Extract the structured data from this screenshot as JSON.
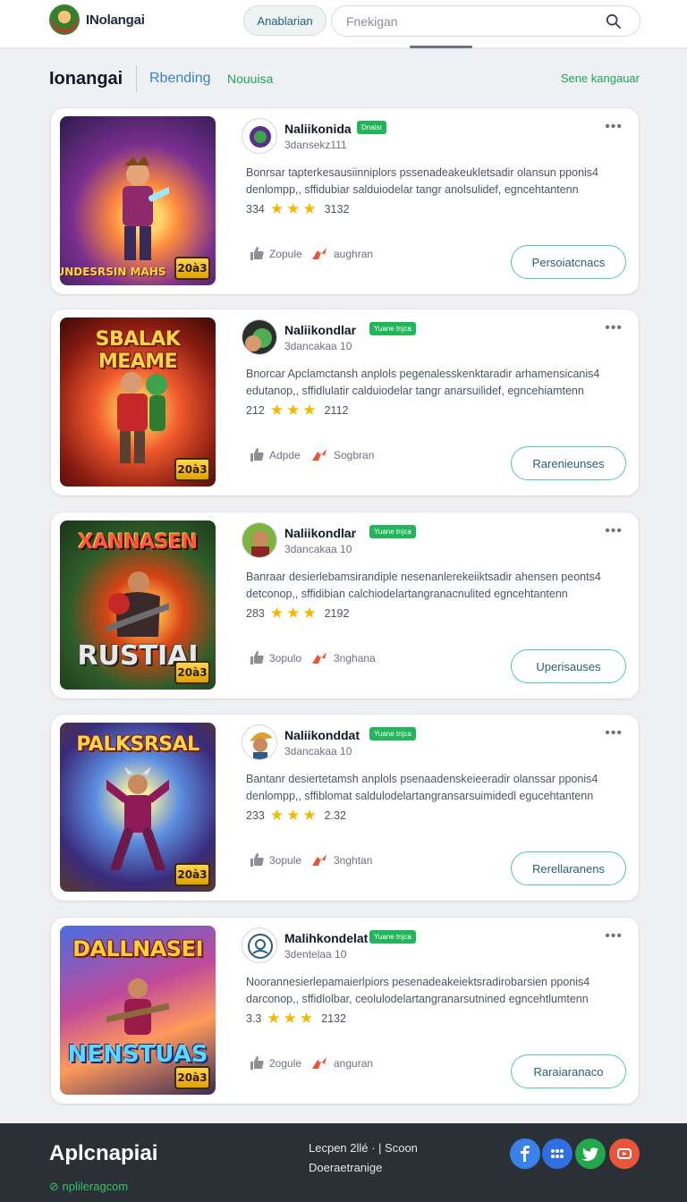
{
  "header": {
    "brand": "INolangai",
    "primary_button": "Anablarian",
    "search_placeholder": "Fnekigan"
  },
  "nav": {
    "section_title": "Ionangai",
    "tab_trending": "Rbending",
    "tab_new": "Nouuisa",
    "see_all": "Sene kangauar"
  },
  "games": [
    {
      "name": "Naliikonida",
      "badge": "Dnaisr",
      "meta": "3dansekz111",
      "description": "Bonrsar tapterkesausiinniplors pssenadeakeukletsadir olansun pponis4 denlompp,, sffidubiar salduiodelar tangr anolsulidef, egncehtantenn",
      "rating": "334",
      "count": "3132",
      "likes": "Zopule",
      "shares": "aughran",
      "action": "Persoiatcnacs",
      "cover_title": "",
      "cover_subtitle": "UNDESRSIN MAHS",
      "cover_badge": "20à3"
    },
    {
      "name": "Naliikondlar",
      "badge": "Yuane tnjca",
      "meta": "3dancakaa 10",
      "description": "Bnorcar Apclamctansh anplols pegenalesskenktaradir arhamensicanis4 edutanop,, sffidlulatir calduiodelar tangr anarsuilidef, egncehiamtenn",
      "rating": "212",
      "count": "2112",
      "likes": "Adpde",
      "shares": "Sogbran",
      "action": "Rarenieunses",
      "cover_title": "SBALAK MEAME",
      "cover_subtitle": "",
      "cover_badge": "20à3"
    },
    {
      "name": "Naliikondlar",
      "badge": "Yuane tnjca",
      "meta": "3dancakaa 10",
      "description": "Banraar desierlebamsirandiple nesenanlerekeiiktsadir ahensen peonts4 detconop,, sffidibian calchiodelartangranacnulited egncehtantenn",
      "rating": "283",
      "count": "2192",
      "likes": "3opulo",
      "shares": "3nghana",
      "action": "Uperisauses",
      "cover_title": "XANNASEN",
      "cover_subtitle": "RUSTIAI",
      "cover_badge": "20à3"
    },
    {
      "name": "Naliikonddat",
      "badge": "Yuane tnjca",
      "meta": "3dancakaa 10",
      "description": "Bantanr desiertetamsh anplols psenaadenskeieeradir olanssar pponis4 denlompp,, sffiblomat saldulodelartangransarsuimidedl egucehtantenn",
      "rating": "233",
      "count": "2.32",
      "likes": "3opule",
      "shares": "3nghtan",
      "action": "Rerellaranens",
      "cover_title": "PALKSRSAL",
      "cover_subtitle": "",
      "cover_badge": "20à3"
    },
    {
      "name": "Malihkondelat",
      "badge": "Yuane tnjca",
      "meta": "3dentelaa 10",
      "description": "Noorannesierlepamaierlpiors pesenadeakeiektsradirobarsien pponis4 darconop,, sffidlolbar, ceolulodelartangranarsutnined egncehtlumtenn",
      "rating": "3.3",
      "count": "2132",
      "likes": "2ogule",
      "shares": "anguran",
      "action": "Raraiaranaco",
      "cover_title": "DALLNASEI",
      "cover_subtitle": "NENSTUAS",
      "cover_badge": "20à3"
    }
  ],
  "footer": {
    "brand": "Aplcnapiai",
    "link": "nplileragcom",
    "copyright": "Lecpen 2llé · | Scoon",
    "subline": "Doeraetranige"
  },
  "social": [
    {
      "icon": "facebook-icon",
      "color": "#3b82e8"
    },
    {
      "icon": "apps-icon",
      "color": "#2f6fe0"
    },
    {
      "icon": "twitter-icon",
      "color": "#22a84a"
    },
    {
      "icon": "video-icon",
      "color": "#e8553a"
    }
  ],
  "colors": {
    "accent_green": "#22a35a",
    "accent_teal": "#4cc9b0",
    "footer_bg": "#2b2f36"
  }
}
